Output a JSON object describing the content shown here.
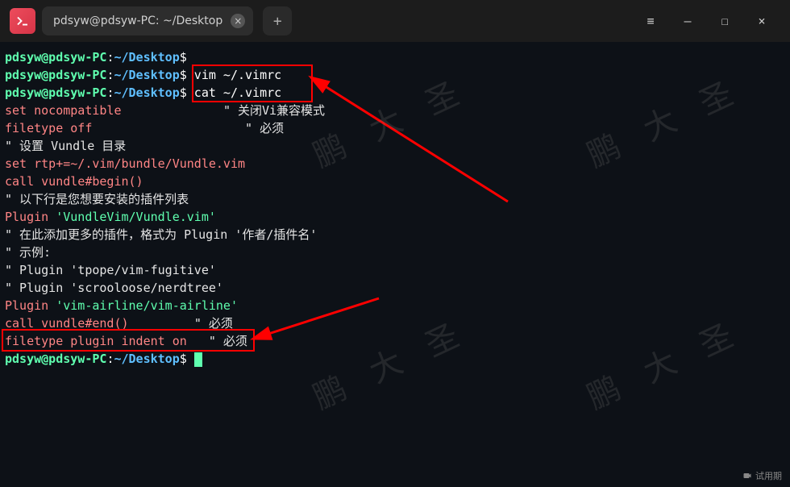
{
  "titlebar": {
    "tab_title": "pdsyw@pdsyw-PC: ~/Desktop",
    "close_glyph": "×",
    "plus_glyph": "+",
    "menu_glyph": "≡",
    "min_glyph": "—",
    "max_glyph": "☐",
    "winclose_glyph": "×"
  },
  "prompt": {
    "user": "pdsyw@pdsyw-PC",
    "sep": ":",
    "path": "~/Desktop",
    "dollar": "$"
  },
  "cmds": {
    "empty": "",
    "vim": " vim ~/.vimrc",
    "cat": " cat ~/.vimrc"
  },
  "output": {
    "l1a": "set nocompatible",
    "l1b": "\" 关闭Vi兼容模式",
    "l2a": "filetype off",
    "l2b": "\" 必须",
    "l3": "",
    "l4": "\" 设置 Vundle 目录",
    "l5a": "set rtp+=~/.vim/bundle/Vundle.vim",
    "l6a": "call vundle#begin()",
    "l7": "\" 以下行是您想要安装的插件列表",
    "l8a": "Plugin ",
    "l8b": "'VundleVim/Vundle.vim'",
    "l9": "",
    "l10": "\" 在此添加更多的插件，格式为 Plugin '作者/插件名'",
    "l11": "\" 示例:",
    "l12": "\" Plugin 'tpope/vim-fugitive'",
    "l13": "\" Plugin 'scrooloose/nerdtree'",
    "l14a": "Plugin ",
    "l14b": "'vim-airline/vim-airline'",
    "l15": "",
    "l16a": "call vundle#end()",
    "l16pad": "         ",
    "l16b": "\" 必须",
    "l17a": "filetype plugin indent on",
    "l17pad": "   ",
    "l17b": "\" 必须",
    "pad1": "              ",
    "pad2": "                     "
  },
  "watermark": "鹏 大 圣",
  "status": "试用期"
}
